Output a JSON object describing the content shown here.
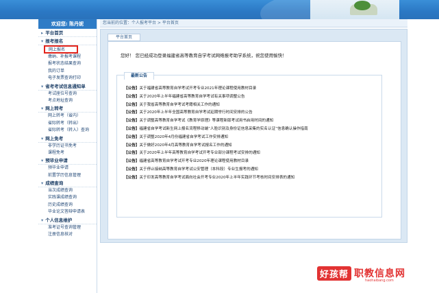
{
  "sidebar": {
    "welcome": "欢迎您: 陈丹妮",
    "sections": [
      {
        "title": "平台首页",
        "items": []
      },
      {
        "title": "报考报名",
        "items": [
          "网上报名",
          "缴纳、补报考课程",
          "报考状态结果查询",
          "我的订单",
          "电子发票查询打印"
        ]
      },
      {
        "title": "省考考试信息通知单",
        "items": [
          "考试座位号查询",
          "考点地址查询"
        ]
      },
      {
        "title": "网上转考",
        "items": [
          "网上转考（省内）",
          "省际转考（转出）",
          "省际转考（转入）查询"
        ]
      },
      {
        "title": "网上免考",
        "items": [
          "非学历证书免考",
          "课程免考"
        ]
      },
      {
        "title": "预毕业申请",
        "items": [
          "预毕业申请",
          "前置学历信息管理"
        ]
      },
      {
        "title": "成绩查询",
        "items": [
          "当次成绩查询",
          "实践课成绩查询",
          "历史成绩查询",
          "毕业论文答辩申请表"
        ]
      },
      {
        "title": "个人信息维护",
        "items": [
          "准考证号查询管理",
          "注册信息核对"
        ]
      }
    ]
  },
  "breadcrumb": "您当前的位置：个人报考平台 > 平台首页",
  "tab_label": "平台首页",
  "greeting": "您好！ 您已经成功登录福建省高等教育自学考试网络报考助学系统，祝您使用愉快！",
  "notice_title": "最新公告",
  "notices": [
    "关于福建省高等教育自学考试开考专业2021年理论课程使用教材目录",
    "关于2020年上半年福建省高等教育自学考试有关事项调整公告",
    "关于我省高等教育自学考试考籍相关工作的通知",
    "关于2020年上半年全国高等教育自学考试延期举行时间安排的公告",
    "关于调整高等教育自学考试《教育学原理》等课程新版考试用书启用时间的通知",
    "福建省自学考试新生网上报名流程移动端“人脸识别及身份证信息采集的实名认证”信息确认操作指南",
    "关于调整2020年4月份福建省自学考试工作安排通知",
    "关于做好2020年4月高等教育自学考试报名工作的通知",
    "关于2020年上半年高等教育自学考试开考专业部分课程考试安排的通知",
    "福建省高等教育自学考试开考专业2020年理论课程使用教材目录",
    "关于停止接纳高等教育自学考试公安管理（本科段）专业生报考的通知",
    "关于印发高等教育自学考试面向社会开考专业2020年上半年实践环节考核时间安排表的通知"
  ],
  "notice_tag": "【公告】",
  "watermark": {
    "brand": "好孩帮",
    "site": "职教信息网",
    "url": "haohaibang.com"
  },
  "colors": {
    "accent": "#2f7cc6",
    "highlight": "#e2231a"
  }
}
